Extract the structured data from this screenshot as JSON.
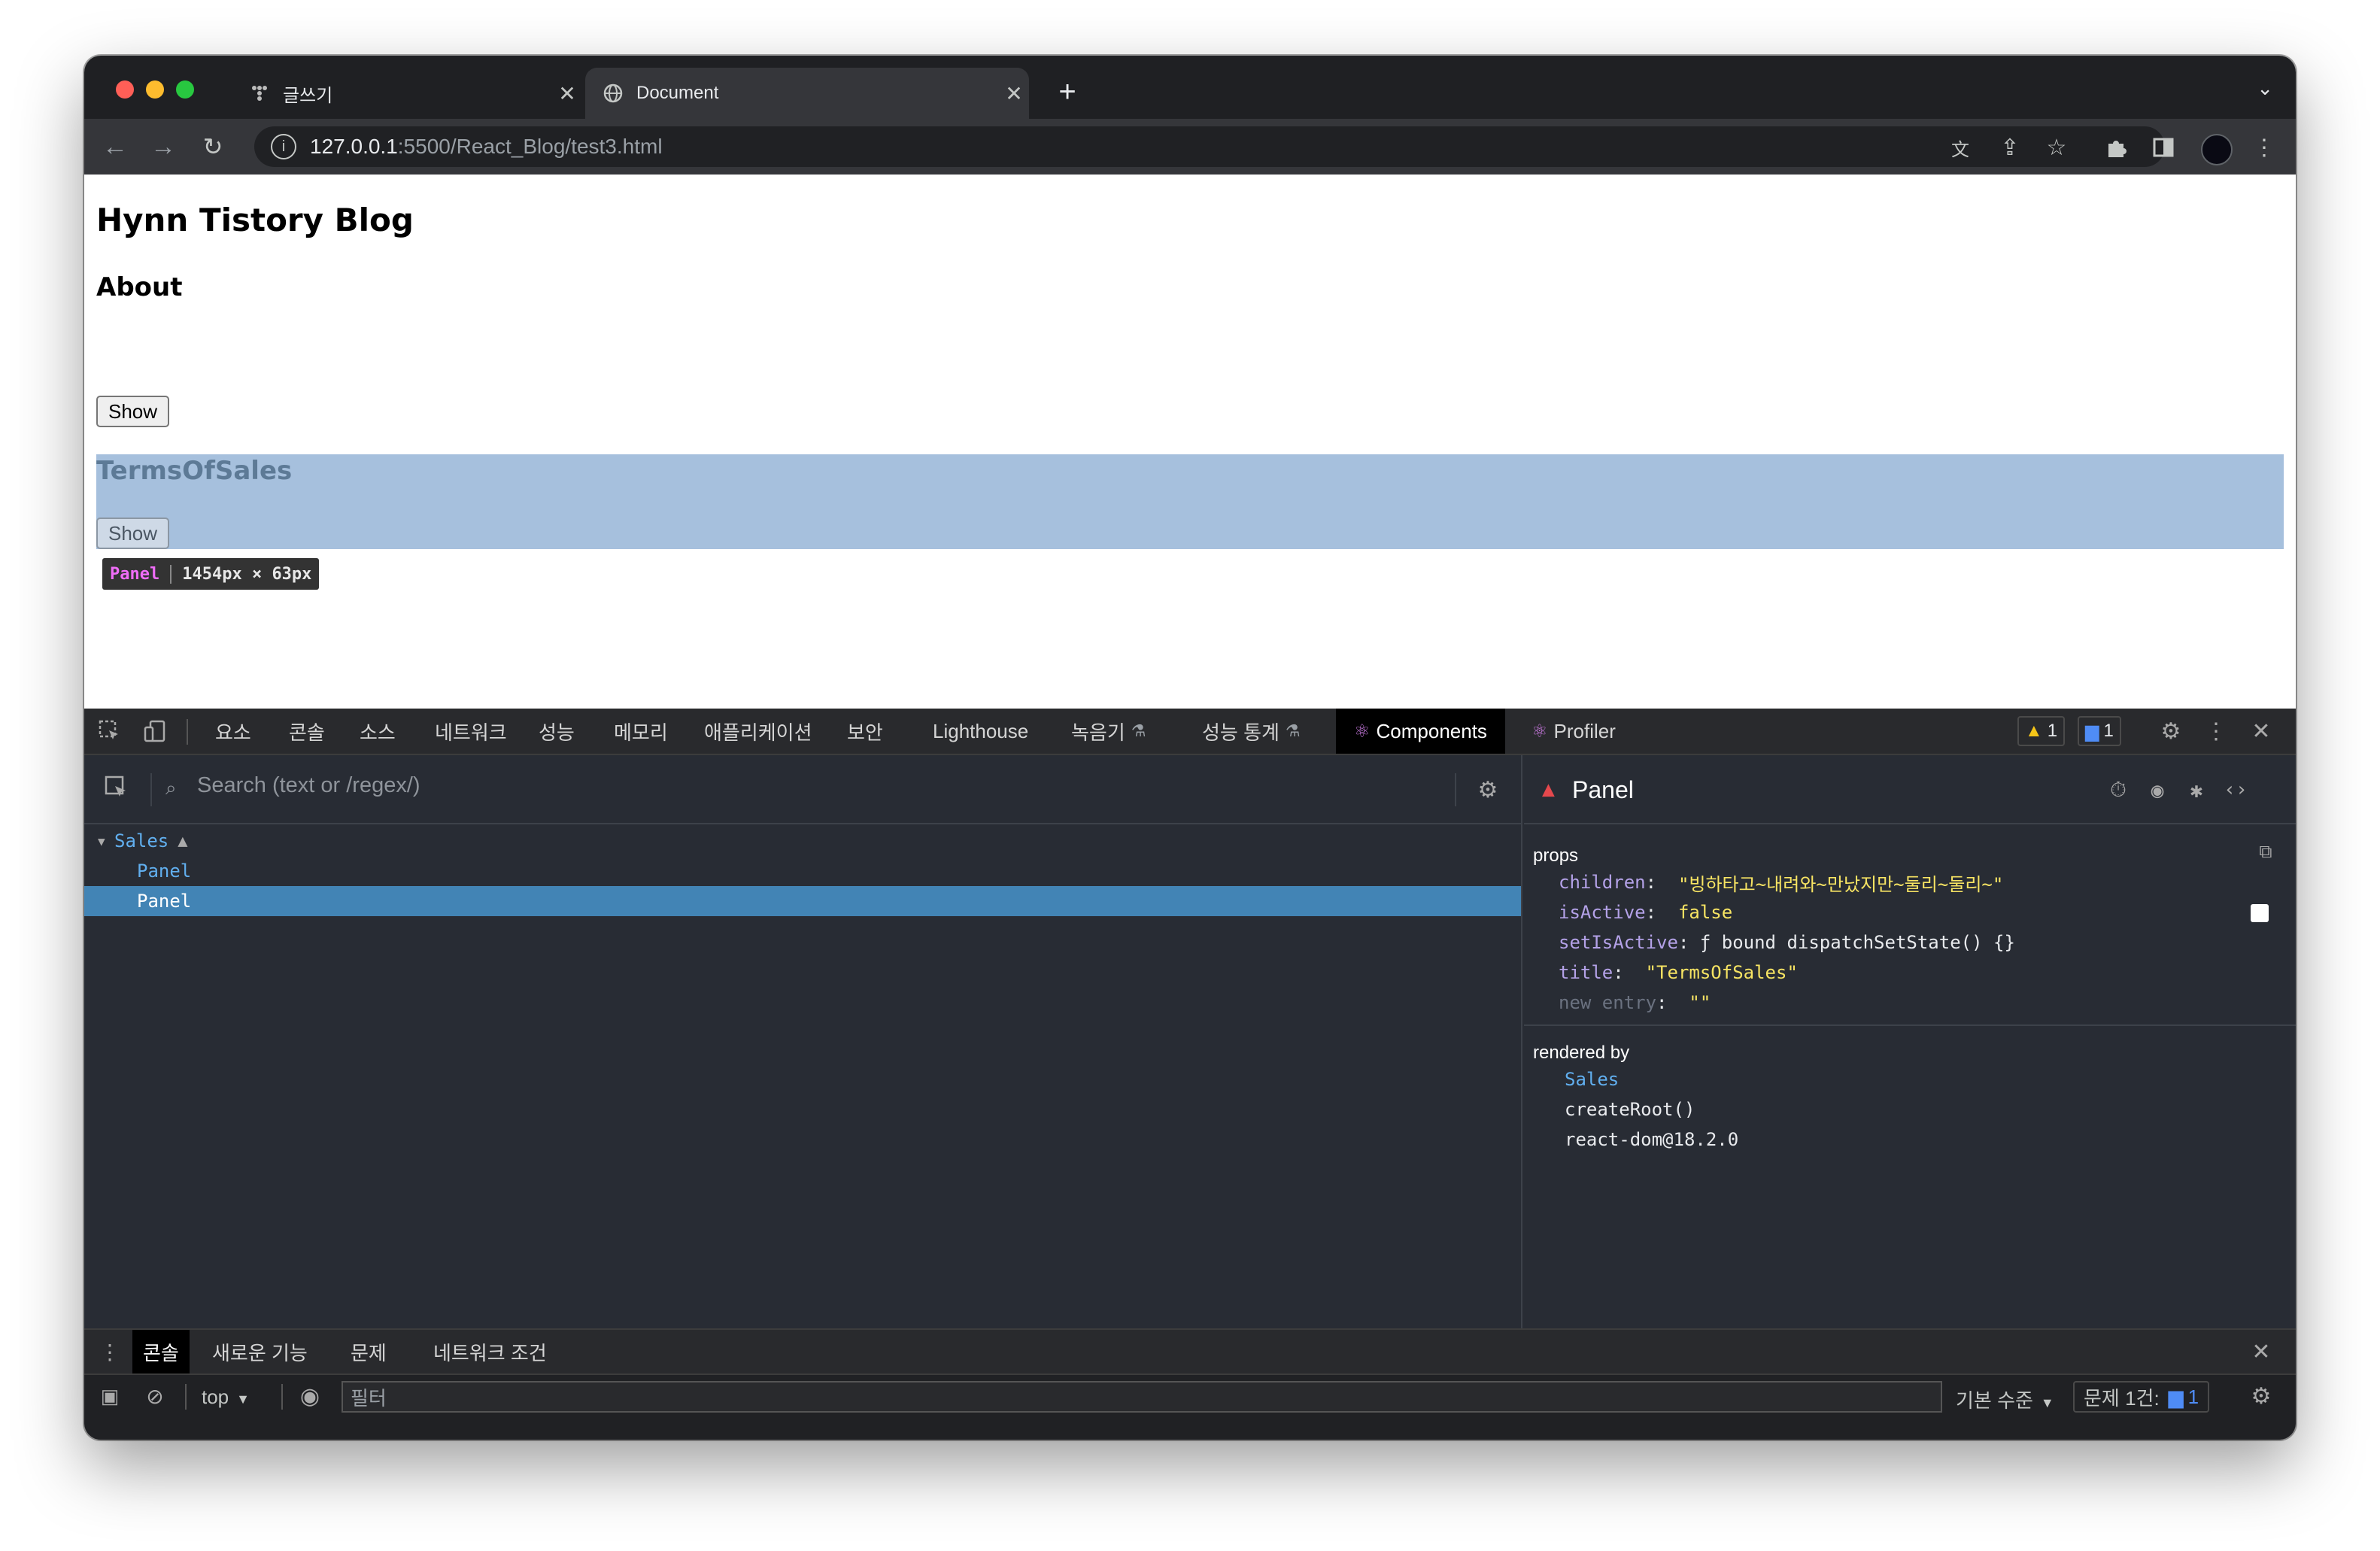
{
  "browser": {
    "tabs": [
      {
        "title": "글쓰기",
        "active": false
      },
      {
        "title": "Document",
        "active": true
      }
    ],
    "url_host": "127.0.0.1",
    "url_path": ":5500/React_Blog/test3.html"
  },
  "page": {
    "heading": "Hynn Tistory Blog",
    "subheading": "About",
    "show_button_1": "Show",
    "panel_title": "TermsOfSales",
    "show_button_2": "Show",
    "tooltip_name": "Panel",
    "tooltip_size": "1454px × 63px"
  },
  "devtools": {
    "tabs": [
      "요소",
      "콘솔",
      "소스",
      "네트워크",
      "성능",
      "메모리",
      "애플리케이션",
      "보안",
      "Lighthouse",
      "녹음기",
      "성능 통계",
      "Components",
      "Profiler"
    ],
    "active_tab": "Components",
    "warning_count": "1",
    "message_count": "1",
    "search_placeholder": "Search (text or /regex/)",
    "tree": [
      {
        "name": "Sales",
        "selected": false
      },
      {
        "name": "Panel",
        "selected": false
      },
      {
        "name": "Panel",
        "selected": true
      }
    ],
    "selected_component": "Panel",
    "props_label": "props",
    "props": [
      {
        "key": "children",
        "value": "\"빙하타고~내려와~만났지만~둘리~둘리~\""
      },
      {
        "key": "isActive",
        "value": "false"
      },
      {
        "key": "setIsActive",
        "value": "ƒ bound dispatchSetState() {}"
      },
      {
        "key": "title",
        "value": "\"TermsOfSales\""
      },
      {
        "key": "new entry",
        "value": "\"\""
      }
    ],
    "rendered_by_label": "rendered by",
    "rendered_by": [
      "Sales",
      "createRoot()",
      "react-dom@18.2.0"
    ],
    "drawer_tabs": [
      "콘솔",
      "새로운 기능",
      "문제",
      "네트워크 조건"
    ],
    "context": "top",
    "filter_placeholder": "필터",
    "levels": "기본 수준",
    "issues": "문제 1건:",
    "issues_count": "1"
  },
  "colors": {
    "highlight": "#a6c0dd",
    "selected_row": "#4284b5",
    "component_name": "#61afef",
    "prop_value": "#f7e463"
  }
}
